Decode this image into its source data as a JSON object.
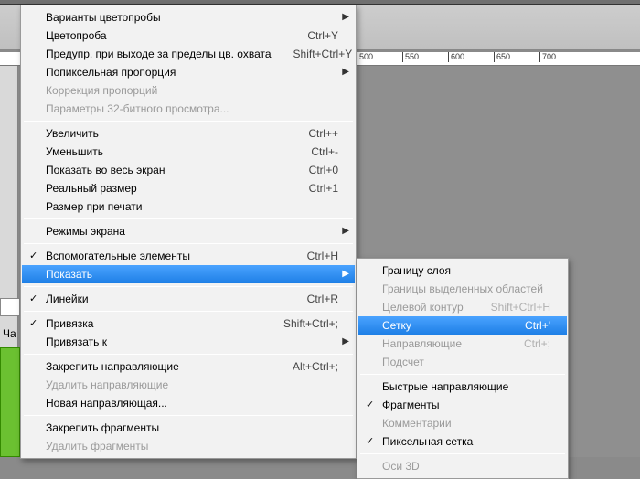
{
  "ruler": {
    "ticks": [
      "500",
      "550",
      "600",
      "650",
      "700"
    ]
  },
  "leftLabel": "Ча",
  "mainMenu": [
    {
      "type": "item",
      "label": "Варианты цветопробы",
      "submenu": true
    },
    {
      "type": "item",
      "label": "Цветопроба",
      "shortcut": "Ctrl+Y"
    },
    {
      "type": "item",
      "label": "Предупр. при выходе за пределы цв. охвата",
      "shortcut": "Shift+Ctrl+Y"
    },
    {
      "type": "item",
      "label": "Попиксельная пропорция",
      "submenu": true
    },
    {
      "type": "item",
      "label": "Коррекция пропорций",
      "disabled": true
    },
    {
      "type": "item",
      "label": "Параметры 32-битного просмотра...",
      "disabled": true
    },
    {
      "type": "sep"
    },
    {
      "type": "item",
      "label": "Увеличить",
      "shortcut": "Ctrl++"
    },
    {
      "type": "item",
      "label": "Уменьшить",
      "shortcut": "Ctrl+-"
    },
    {
      "type": "item",
      "label": "Показать во весь экран",
      "shortcut": "Ctrl+0"
    },
    {
      "type": "item",
      "label": "Реальный размер",
      "shortcut": "Ctrl+1"
    },
    {
      "type": "item",
      "label": "Размер при печати"
    },
    {
      "type": "sep"
    },
    {
      "type": "item",
      "label": "Режимы экрана",
      "submenu": true
    },
    {
      "type": "sep"
    },
    {
      "type": "item",
      "label": "Вспомогательные элементы",
      "shortcut": "Ctrl+H",
      "checked": true
    },
    {
      "type": "item",
      "label": "Показать",
      "submenu": true,
      "highlight": true
    },
    {
      "type": "sep"
    },
    {
      "type": "item",
      "label": "Линейки",
      "shortcut": "Ctrl+R",
      "checked": true
    },
    {
      "type": "sep"
    },
    {
      "type": "item",
      "label": "Привязка",
      "shortcut": "Shift+Ctrl+;",
      "checked": true
    },
    {
      "type": "item",
      "label": "Привязать к",
      "submenu": true
    },
    {
      "type": "sep"
    },
    {
      "type": "item",
      "label": "Закрепить направляющие",
      "shortcut": "Alt+Ctrl+;"
    },
    {
      "type": "item",
      "label": "Удалить направляющие",
      "disabled": true
    },
    {
      "type": "item",
      "label": "Новая направляющая..."
    },
    {
      "type": "sep"
    },
    {
      "type": "item",
      "label": "Закрепить фрагменты"
    },
    {
      "type": "item",
      "label": "Удалить фрагменты",
      "disabled": true
    }
  ],
  "subMenu": [
    {
      "type": "item",
      "label": "Границу слоя"
    },
    {
      "type": "item",
      "label": "Границы выделенных областей",
      "disabled": true
    },
    {
      "type": "item",
      "label": "Целевой контур",
      "shortcut": "Shift+Ctrl+H",
      "disabled": true
    },
    {
      "type": "item",
      "label": "Сетку",
      "shortcut": "Ctrl+'",
      "highlight": true
    },
    {
      "type": "item",
      "label": "Направляющие",
      "shortcut": "Ctrl+;",
      "disabled": true
    },
    {
      "type": "item",
      "label": "Подсчет",
      "disabled": true
    },
    {
      "type": "sep"
    },
    {
      "type": "item",
      "label": "Быстрые направляющие"
    },
    {
      "type": "item",
      "label": "Фрагменты",
      "checked": true
    },
    {
      "type": "item",
      "label": "Комментарии",
      "disabled": true
    },
    {
      "type": "item",
      "label": "Пиксельная сетка",
      "checked": true
    },
    {
      "type": "sep"
    },
    {
      "type": "item",
      "label": "Оси 3D",
      "disabled": true
    }
  ]
}
